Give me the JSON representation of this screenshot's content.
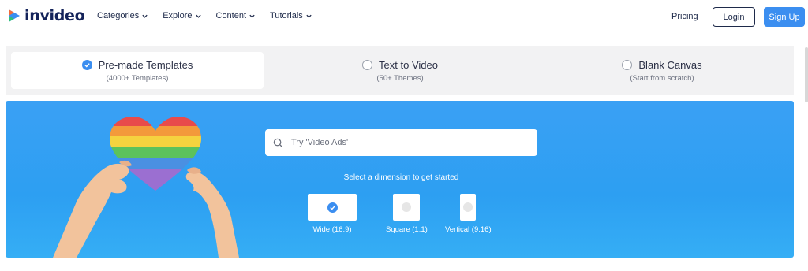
{
  "brand": {
    "name": "invideo",
    "accent": "#3b8ef0",
    "text_color": "#14235a"
  },
  "nav": {
    "items": [
      {
        "label": "Categories",
        "icon": "chevron-down-icon"
      },
      {
        "label": "Explore",
        "icon": "chevron-down-icon"
      },
      {
        "label": "Content",
        "icon": "chevron-down-icon"
      },
      {
        "label": "Tutorials",
        "icon": "chevron-down-icon"
      }
    ],
    "pricing": "Pricing",
    "login": "Login",
    "signup": "Sign Up"
  },
  "modes": [
    {
      "title": "Pre-made Templates",
      "subtitle": "(4000+ Templates)",
      "selected": true
    },
    {
      "title": "Text to Video",
      "subtitle": "(50+ Themes)",
      "selected": false
    },
    {
      "title": "Blank Canvas",
      "subtitle": "(Start from scratch)",
      "selected": false
    }
  ],
  "hero": {
    "search_placeholder": "Try 'Video Ads'",
    "search_icon": "search-icon",
    "dimension_prompt": "Select a dimension to get started",
    "dimensions": [
      {
        "label": "Wide (16:9)",
        "selected": true
      },
      {
        "label": "Square (1:1)",
        "selected": false
      },
      {
        "label": "Vertical (9:16)",
        "selected": false
      }
    ],
    "background_color": "#2d9ff2"
  }
}
